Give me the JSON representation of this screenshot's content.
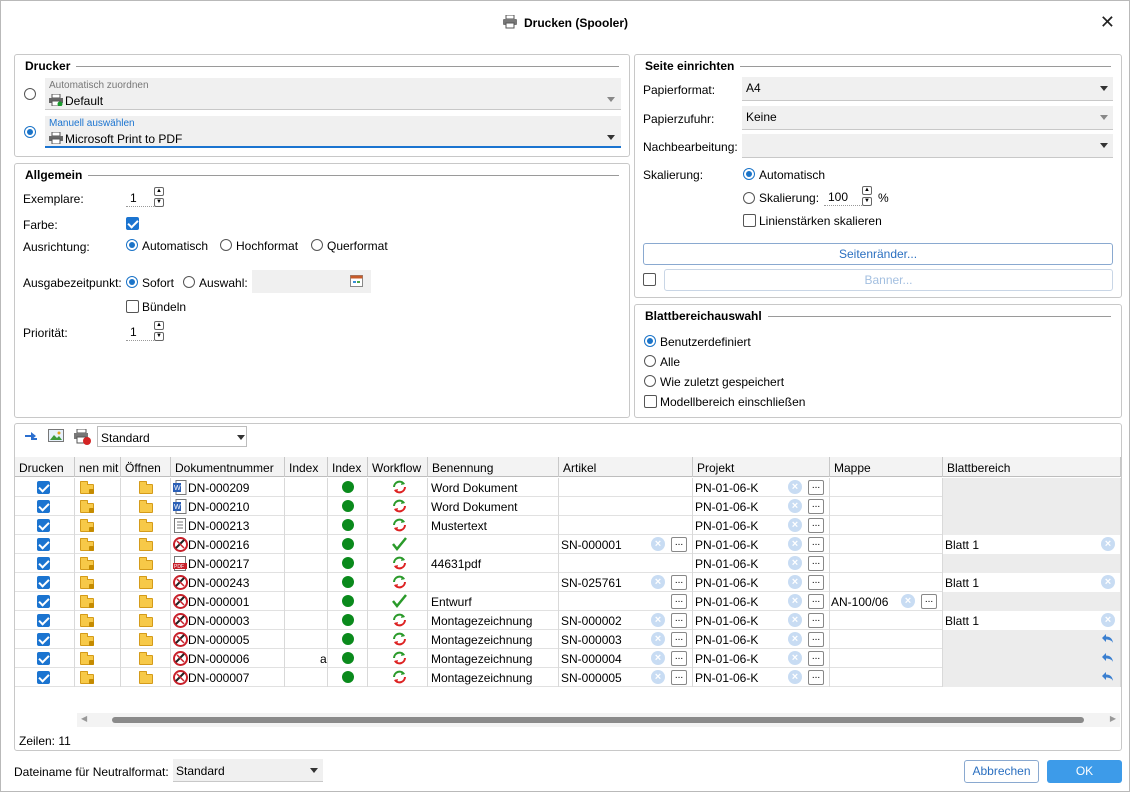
{
  "title": "Drucken (Spooler)",
  "drucker": {
    "section_title": "Drucker",
    "auto_label": "Automatisch zuordnen",
    "auto_value": "Default",
    "manual_label": "Manuell auswählen",
    "manual_value": "Microsoft Print to PDF"
  },
  "allgemein": {
    "section_title": "Allgemein",
    "exemplare_label": "Exemplare:",
    "exemplare_value": "1",
    "farbe_label": "Farbe:",
    "farbe_checked": true,
    "ausrichtung_label": "Ausrichtung:",
    "ausrichtung_options": [
      "Automatisch",
      "Hochformat",
      "Querformat"
    ],
    "ausrichtung_selected": "Automatisch",
    "ausgabe_label": "Ausgabezeitpunkt:",
    "ausgabe_sofort": "Sofort",
    "ausgabe_auswahl": "Auswahl:",
    "buendeln_label": "Bündeln",
    "prioritaet_label": "Priorität:",
    "prioritaet_value": "1"
  },
  "seite": {
    "section_title": "Seite einrichten",
    "papierformat_label": "Papierformat:",
    "papierformat_value": "A4",
    "papierzufuhr_label": "Papierzufuhr:",
    "papierzufuhr_value": "Keine",
    "nachbearbeitung_label": "Nachbearbeitung:",
    "nachbearbeitung_value": "",
    "skalierung_label": "Skalierung:",
    "skal_auto": "Automatisch",
    "skal_custom": "Skalierung:",
    "skal_value": "100",
    "skal_unit": "%",
    "linien_label": "Linienstärken skalieren",
    "seitenraender_button": "Seitenränder...",
    "banner_button": "Banner..."
  },
  "blatt": {
    "section_title": "Blattbereichauswahl",
    "options": [
      "Benutzerdefiniert",
      "Alle",
      "Wie zuletzt gespeichert"
    ],
    "modell_label": "Modellbereich einschließen"
  },
  "toolbar": {
    "view_value": "Standard"
  },
  "table": {
    "headers": [
      "Drucken",
      "nen mit",
      "Öffnen",
      "Dokumentnummer",
      "Index",
      "Index",
      "Workflow",
      "Benennung",
      "Artikel",
      "Projekt",
      "Mappe",
      "Blattbereich"
    ],
    "rows": [
      {
        "type": "word",
        "nummer": "DN-000209",
        "idx1": "",
        "wf": "cycle",
        "benennung": "Word Dokument",
        "artikel": "",
        "projekt": "PN-01-06-K",
        "mappe": "",
        "blatt": "",
        "blatt_icon": "none"
      },
      {
        "type": "word",
        "nummer": "DN-000210",
        "idx1": "",
        "wf": "cycle",
        "benennung": "Word Dokument",
        "artikel": "",
        "projekt": "PN-01-06-K",
        "mappe": "",
        "blatt": "",
        "blatt_icon": "none"
      },
      {
        "type": "text",
        "nummer": "DN-000213",
        "idx1": "",
        "wf": "cycle",
        "benennung": "Mustertext",
        "artikel": "",
        "projekt": "PN-01-06-K",
        "mappe": "",
        "blatt": "",
        "blatt_icon": "none"
      },
      {
        "type": "cad",
        "nummer": "DN-000216",
        "idx1": "",
        "wf": "check",
        "benennung": "",
        "artikel": "SN-000001",
        "projekt": "PN-01-06-K",
        "mappe": "",
        "blatt": "Blatt 1",
        "blatt_icon": "x"
      },
      {
        "type": "pdf",
        "nummer": "DN-000217",
        "idx1": "",
        "wf": "cycle",
        "benennung": "44631pdf",
        "artikel": "",
        "projekt": "PN-01-06-K",
        "mappe": "",
        "blatt": "",
        "blatt_icon": "none"
      },
      {
        "type": "cad",
        "nummer": "DN-000243",
        "idx1": "",
        "wf": "cycle",
        "benennung": "",
        "artikel": "SN-025761",
        "projekt": "PN-01-06-K",
        "mappe": "",
        "blatt": "Blatt 1",
        "blatt_icon": "x"
      },
      {
        "type": "cad",
        "nummer": "DN-000001",
        "idx1": "",
        "wf": "check",
        "benennung": "Entwurf",
        "artikel": "",
        "projekt": "PN-01-06-K",
        "mappe": "AN-100/06",
        "blatt": "",
        "blatt_icon": "none"
      },
      {
        "type": "cad",
        "nummer": "DN-000003",
        "idx1": "",
        "wf": "cycle",
        "benennung": "Montagezeichnung",
        "artikel": "SN-000002",
        "projekt": "PN-01-06-K",
        "mappe": "",
        "blatt": "Blatt 1",
        "blatt_icon": "x"
      },
      {
        "type": "cad",
        "nummer": "DN-000005",
        "idx1": "",
        "wf": "cycle",
        "benennung": "Montagezeichnung",
        "artikel": "SN-000003",
        "projekt": "PN-01-06-K",
        "mappe": "",
        "blatt": "",
        "blatt_icon": "undo"
      },
      {
        "type": "cad",
        "nummer": "DN-000006",
        "idx1": "a",
        "wf": "cycle",
        "benennung": "Montagezeichnung",
        "artikel": "SN-000004",
        "projekt": "PN-01-06-K",
        "mappe": "",
        "blatt": "",
        "blatt_icon": "undo"
      },
      {
        "type": "cad",
        "nummer": "DN-000007",
        "idx1": "",
        "wf": "cycle",
        "benennung": "Montagezeichnung",
        "artikel": "SN-000005",
        "projekt": "PN-01-06-K",
        "mappe": "",
        "blatt": "",
        "blatt_icon": "undo"
      }
    ]
  },
  "footer": {
    "zeilen": "Zeilen: 11",
    "dateiname_label": "Dateiname für Neutralformat:",
    "dateiname_value": "Standard",
    "abbrechen": "Abbrechen",
    "ok": "OK"
  },
  "colors": {
    "accent": "#1b74d0",
    "green": "#0a8a1c",
    "ok_bg": "#3d9be9"
  }
}
